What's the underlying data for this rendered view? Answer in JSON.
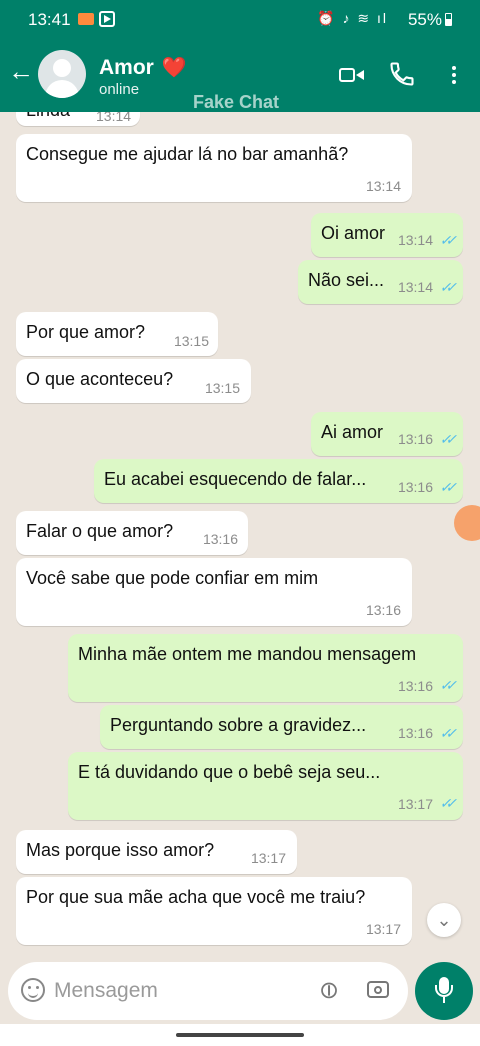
{
  "status_bar": {
    "time": "13:41",
    "battery": "55%"
  },
  "header": {
    "name": "Amor",
    "heart": "❤️",
    "status": "online",
    "overlay": "Fake Chat"
  },
  "colors": {
    "header": "#008069",
    "incoming": "#ffffff",
    "outgoing": "#dcf8c6",
    "tick": "#53bdeb"
  },
  "messages": [
    {
      "dir": "in",
      "text": "Linda",
      "time": "13:14"
    },
    {
      "dir": "in",
      "text": "Consegue me ajudar lá no bar amanhã?",
      "time": "13:14"
    },
    {
      "dir": "out",
      "text": "Oi amor",
      "time": "13:14"
    },
    {
      "dir": "out",
      "text": "Não sei...",
      "time": "13:14"
    },
    {
      "dir": "in",
      "text": "Por que amor?",
      "time": "13:15"
    },
    {
      "dir": "in",
      "text": "O que aconteceu?",
      "time": "13:15"
    },
    {
      "dir": "out",
      "text": "Ai amor",
      "time": "13:16"
    },
    {
      "dir": "out",
      "text": "Eu acabei esquecendo de falar...",
      "time": "13:16"
    },
    {
      "dir": "in",
      "text": "Falar o que amor?",
      "time": "13:16"
    },
    {
      "dir": "in",
      "text": "Você sabe que pode confiar em mim",
      "time": "13:16"
    },
    {
      "dir": "out",
      "text": "Minha mãe ontem me mandou mensagem",
      "time": "13:16"
    },
    {
      "dir": "out",
      "text": "Perguntando sobre a gravidez...",
      "time": "13:16"
    },
    {
      "dir": "out",
      "text": "E tá duvidando que o bebê seja seu...",
      "time": "13:17"
    },
    {
      "dir": "in",
      "text": "Mas porque isso amor?",
      "time": "13:17"
    },
    {
      "dir": "in",
      "text": "Por que sua mãe acha que você me traiu?",
      "time": "13:17"
    }
  ],
  "input": {
    "placeholder": "Mensagem"
  },
  "icons": [
    "back-arrow-icon",
    "video-call-icon",
    "phone-call-icon",
    "more-options-icon",
    "emoji-icon",
    "attach-icon",
    "camera-icon",
    "mic-icon",
    "scroll-down-icon"
  ]
}
